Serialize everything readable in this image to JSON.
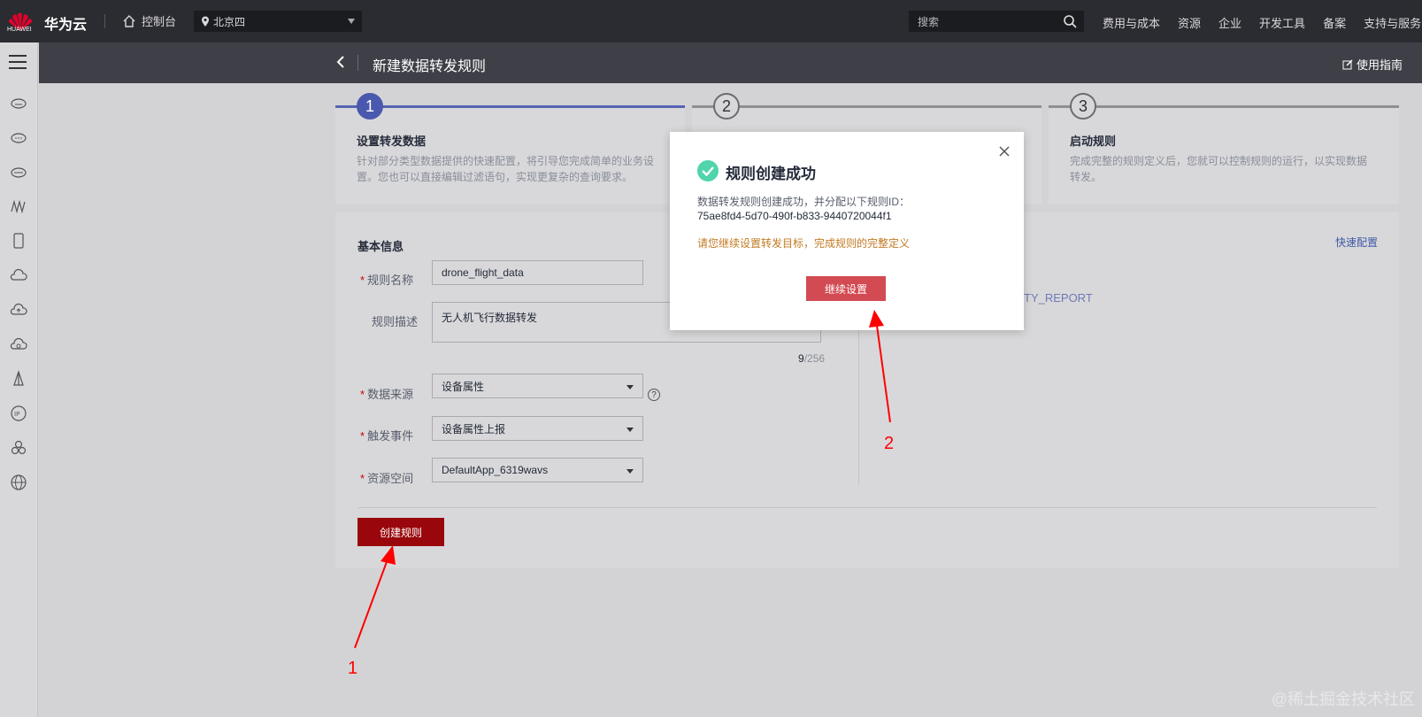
{
  "topbar": {
    "logo_text": "HUAWEI",
    "brand": "华为云",
    "console": "控制台",
    "region": "北京四",
    "search_placeholder": "搜索",
    "nav": [
      "费用与成本",
      "资源",
      "企业",
      "开发工具",
      "备案",
      "支持与服务"
    ]
  },
  "page": {
    "title": "新建数据转发规则",
    "guide": "使用指南"
  },
  "steps": [
    {
      "num": "1",
      "title": "设置转发数据",
      "desc": "针对部分类型数据提供的快速配置，将引导您完成简单的业务设置。您也可以直接编辑过滤语句，实现更复杂的查询要求。"
    },
    {
      "num": "2",
      "title": "",
      "desc": ""
    },
    {
      "num": "3",
      "title": "启动规则",
      "desc": "完成完整的规则定义后，您就可以控制规则的运行，以实现数据转发。"
    }
  ],
  "form": {
    "section": "基本信息",
    "rule_name_label": "规则名称",
    "rule_name_value": "drone_flight_data",
    "rule_desc_label": "规则描述",
    "rule_desc_value": "无人机飞行数据转发",
    "counter_cur": "9",
    "counter_max": "/256",
    "source_label": "数据来源",
    "source_value": "设备属性",
    "trigger_label": "触发事件",
    "trigger_value": "设备属性上报",
    "space_label": "资源空间",
    "space_value": "DefaultApp_6319wavs",
    "quick_config": "快速配置",
    "topic_partial": "TY_REPORT",
    "create_button": "创建规则"
  },
  "modal": {
    "title": "规则创建成功",
    "desc": "数据转发规则创建成功，并分配以下规则ID：",
    "rule_id": "75ae8fd4-5d70-490f-b833-9440720044f1",
    "warning": "请您继续设置转发目标，完成规则的完整定义",
    "continue_button": "继续设置"
  },
  "annotations": {
    "one": "1",
    "two": "2"
  },
  "watermark": "@稀土掘金技术社区",
  "colors": {
    "brand_red": "#c7000b",
    "step_active": "#4a58ae",
    "success": "#50d4ab",
    "warning": "#c27a23"
  },
  "icons": [
    "home-icon",
    "location-pin-icon",
    "search-icon",
    "menu-icon",
    "close-icon",
    "check-circle-icon",
    "help-icon",
    "edit-icon",
    "back-arrow-icon"
  ]
}
